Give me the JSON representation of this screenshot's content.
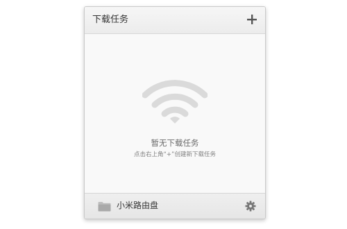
{
  "header": {
    "title": "下载任务",
    "add_icon": "plus-icon"
  },
  "empty_state": {
    "icon": "wifi-icon",
    "title": "暂无下载任务",
    "hint": "点击右上角“+”创建新下载任务"
  },
  "footer": {
    "folder_icon": "folder-icon",
    "label": "小米路由盘",
    "settings_icon": "gear-icon"
  },
  "colors": {
    "icon_gray": "#dadada",
    "text_dark": "#333333",
    "text_muted": "#6a6a6a"
  }
}
